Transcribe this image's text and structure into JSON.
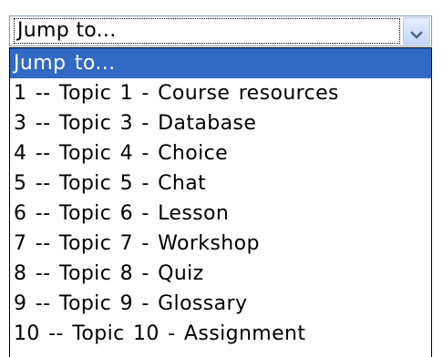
{
  "select": {
    "value": "Jump to...",
    "icon": "chevron-down-icon"
  },
  "options": [
    {
      "label": "Jump to...",
      "selected": true
    },
    {
      "label": "1 -- Topic 1 - Course resources",
      "selected": false
    },
    {
      "label": "3 -- Topic 3 - Database",
      "selected": false
    },
    {
      "label": "4 -- Topic 4 - Choice",
      "selected": false
    },
    {
      "label": "5 -- Topic 5 - Chat",
      "selected": false
    },
    {
      "label": "6 -- Topic 6 - Lesson",
      "selected": false
    },
    {
      "label": "7 -- Topic 7 - Workshop",
      "selected": false
    },
    {
      "label": "8 -- Topic 8 - Quiz",
      "selected": false
    },
    {
      "label": "9 -- Topic 9 - Glossary",
      "selected": false
    },
    {
      "label": "10 -- Topic 10 - Assignment",
      "selected": false
    }
  ],
  "colors": {
    "highlight": "#316ac5",
    "border": "#7f9db9",
    "button_arrow": "#4d6185"
  }
}
